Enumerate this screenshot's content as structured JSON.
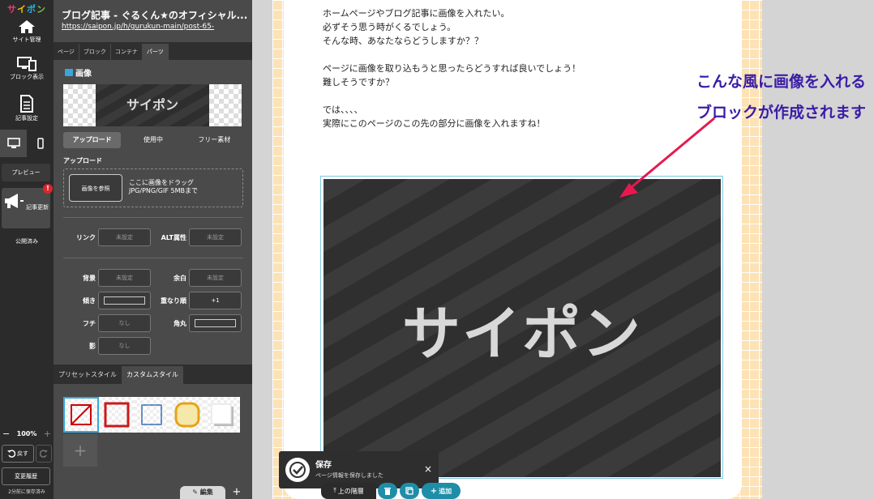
{
  "rail": {
    "logo": [
      "サ",
      "イ",
      "ポ",
      "ン"
    ],
    "site_manage": "サイト管理",
    "block_view": "ブロック表示",
    "article_settings": "記事設定",
    "preview": "プレビュー",
    "update_article": "記事更新",
    "alert_mark": "!",
    "publish_state": "公開済み",
    "zoom": "100%",
    "zoom_minus": "−",
    "zoom_plus": "+",
    "undo": "戻す",
    "history": "変更履歴",
    "autosave": "2分前に保存済み"
  },
  "panel": {
    "title": "ブログ記事 - ぐるくん★のオフィシャル...",
    "url": "https://saipon.jp/h/gurukun-main/post-65-",
    "tabs": [
      "ページ",
      "ブロック",
      "コンテナ",
      "パーツ"
    ],
    "active_tab": 3,
    "section_title": "画像",
    "thumb_text": "サイポン",
    "subtabs": [
      "アップロード",
      "使用中",
      "フリー素材"
    ],
    "active_subtab": 0,
    "upload_label": "アップロード",
    "browse_button": "画像を参照",
    "drop_line1": "ここに画像をドラッグ",
    "drop_line2": "JPG/PNG/GIF 5MBまで",
    "link_label": "リンク",
    "link_value": "未設定",
    "alt_label": "ALT属性",
    "alt_value": "未設定",
    "bg_label": "背景",
    "bg_value": "未設定",
    "margin_label": "余白",
    "margin_value": "未設定",
    "tilt_label": "傾き",
    "order_label": "重なり順",
    "order_value": "+1",
    "border_label": "フチ",
    "border_value": "なし",
    "radius_label": "角丸",
    "shadow_label": "影",
    "shadow_value": "なし",
    "style_tabs": [
      "プリセットスタイル",
      "カスタムスタイル"
    ],
    "active_style_tab": 1,
    "add_swatch": "+",
    "edit_button": "編集",
    "plus_button": "+"
  },
  "page": {
    "lines": [
      "ホームページやブログ記事に画像を入れたい。",
      "必ずそう思う時がくるでしょう。",
      "そんな時、あなたならどうしますか？？",
      "",
      "ページに画像を取り込もうと思ったらどうすれば良いでしょう！",
      "難しそうですか？",
      "",
      "では、、、、",
      "実際にこのページのこの先の部分に画像を入れますね！"
    ],
    "image_text": "サイポン",
    "annotation_line1": "こんな風に画像を入れる",
    "annotation_line2": "ブロックが作成されます",
    "annotation_color": "#3a1ca6",
    "arrow_color": "#e8184f"
  },
  "toast": {
    "title": "保存",
    "message": "ページ情報を保存しました",
    "close": "×"
  },
  "block_bar": {
    "up": "上の階層",
    "up_prefix": "⤒",
    "add": "追加",
    "add_prefix": "+"
  }
}
